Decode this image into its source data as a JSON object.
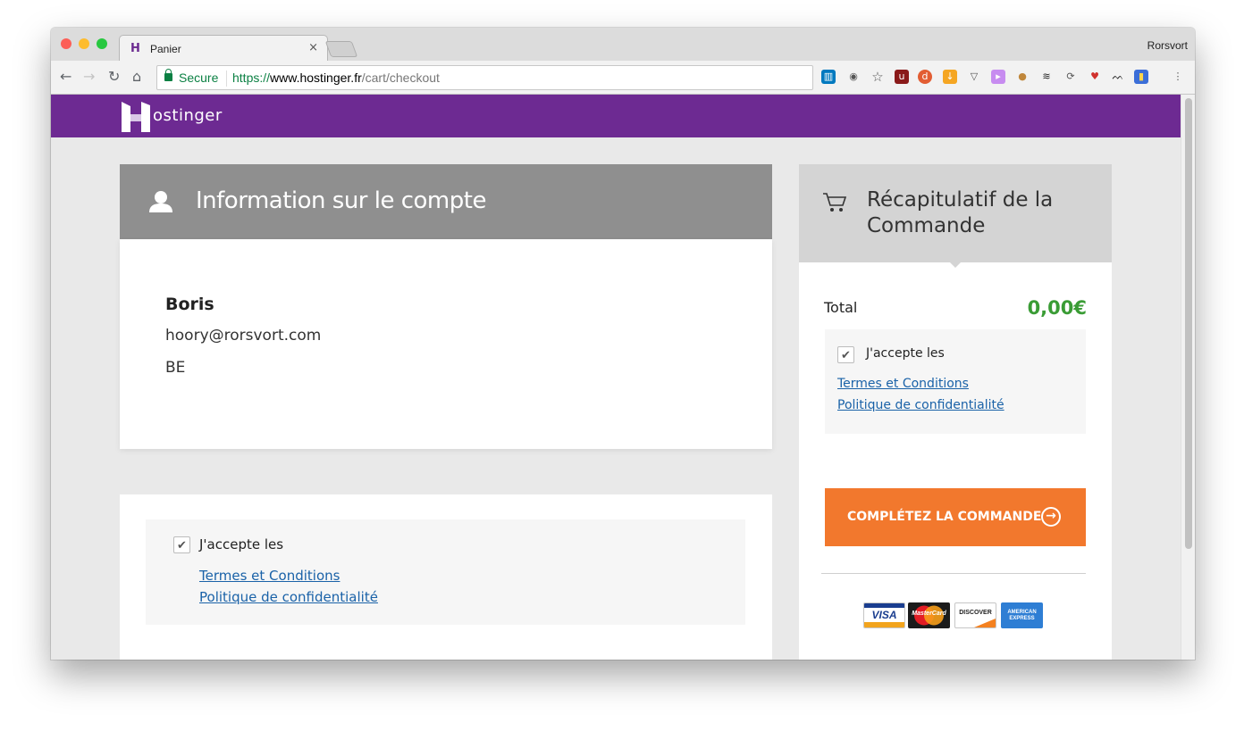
{
  "browser": {
    "tab_title": "Panier",
    "tab_close": "×",
    "profile_name": "Rorsvort",
    "secure_label": "Secure",
    "url_scheme": "https://",
    "url_host": "www.hostinger.fr",
    "url_path": "/cart/checkout"
  },
  "site": {
    "logo_text": "ostinger"
  },
  "account": {
    "title": "Information sur le compte",
    "name": "Boris",
    "email": "hoory@rorsvort.com",
    "country": "BE"
  },
  "terms_main": {
    "accept_label": "J'accepte les",
    "terms_link": "Termes et Conditions",
    "privacy_link": "Politique de confidentialité",
    "checked": true
  },
  "summary": {
    "title": "Récapitulatif de la Commande",
    "total_label": "Total",
    "total_value": "0,00€",
    "accept_label": "J'accepte les",
    "terms_link": "Termes et Conditions",
    "privacy_link": "Politique de confidentialité",
    "checked": true,
    "complete_button": "COMPLÉTEZ LA COMMANDE"
  },
  "payment_logos": {
    "visa": "VISA",
    "mastercard": "MasterCard",
    "discover": "DISCOVER",
    "amex": "AMERICAN EXPRESS"
  },
  "colors": {
    "brand_purple": "#6d2a92",
    "button_orange": "#f2782d",
    "total_green": "#3a9c35",
    "link_blue": "#1a62a8"
  }
}
